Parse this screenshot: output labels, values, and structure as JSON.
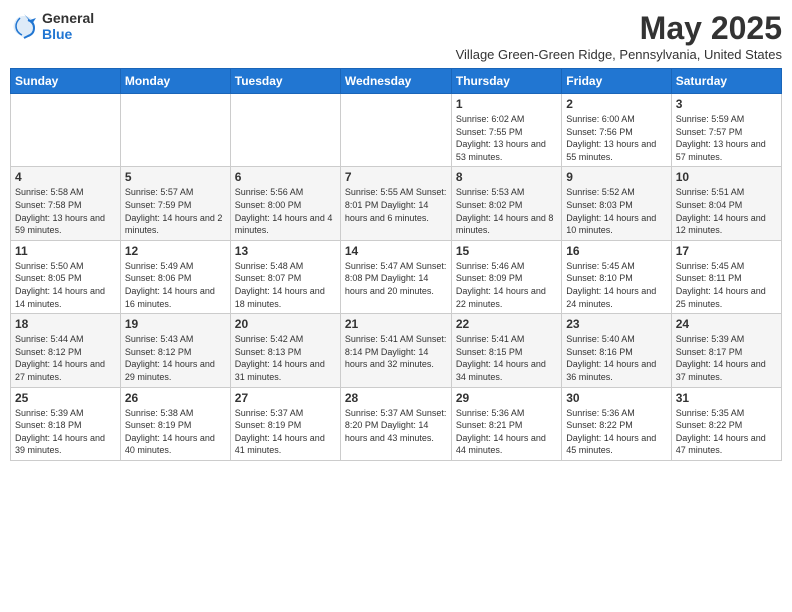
{
  "header": {
    "logo_general": "General",
    "logo_blue": "Blue",
    "month": "May 2025",
    "location": "Village Green-Green Ridge, Pennsylvania, United States"
  },
  "days_of_week": [
    "Sunday",
    "Monday",
    "Tuesday",
    "Wednesday",
    "Thursday",
    "Friday",
    "Saturday"
  ],
  "weeks": [
    {
      "row_class": "row1",
      "days": [
        {
          "num": "",
          "info": ""
        },
        {
          "num": "",
          "info": ""
        },
        {
          "num": "",
          "info": ""
        },
        {
          "num": "",
          "info": ""
        },
        {
          "num": "1",
          "info": "Sunrise: 6:02 AM\nSunset: 7:55 PM\nDaylight: 13 hours\nand 53 minutes."
        },
        {
          "num": "2",
          "info": "Sunrise: 6:00 AM\nSunset: 7:56 PM\nDaylight: 13 hours\nand 55 minutes."
        },
        {
          "num": "3",
          "info": "Sunrise: 5:59 AM\nSunset: 7:57 PM\nDaylight: 13 hours\nand 57 minutes."
        }
      ]
    },
    {
      "row_class": "row2",
      "days": [
        {
          "num": "4",
          "info": "Sunrise: 5:58 AM\nSunset: 7:58 PM\nDaylight: 13 hours\nand 59 minutes."
        },
        {
          "num": "5",
          "info": "Sunrise: 5:57 AM\nSunset: 7:59 PM\nDaylight: 14 hours\nand 2 minutes."
        },
        {
          "num": "6",
          "info": "Sunrise: 5:56 AM\nSunset: 8:00 PM\nDaylight: 14 hours\nand 4 minutes."
        },
        {
          "num": "7",
          "info": "Sunrise: 5:55 AM\nSunset: 8:01 PM\nDaylight: 14 hours\nand 6 minutes."
        },
        {
          "num": "8",
          "info": "Sunrise: 5:53 AM\nSunset: 8:02 PM\nDaylight: 14 hours\nand 8 minutes."
        },
        {
          "num": "9",
          "info": "Sunrise: 5:52 AM\nSunset: 8:03 PM\nDaylight: 14 hours\nand 10 minutes."
        },
        {
          "num": "10",
          "info": "Sunrise: 5:51 AM\nSunset: 8:04 PM\nDaylight: 14 hours\nand 12 minutes."
        }
      ]
    },
    {
      "row_class": "row3",
      "days": [
        {
          "num": "11",
          "info": "Sunrise: 5:50 AM\nSunset: 8:05 PM\nDaylight: 14 hours\nand 14 minutes."
        },
        {
          "num": "12",
          "info": "Sunrise: 5:49 AM\nSunset: 8:06 PM\nDaylight: 14 hours\nand 16 minutes."
        },
        {
          "num": "13",
          "info": "Sunrise: 5:48 AM\nSunset: 8:07 PM\nDaylight: 14 hours\nand 18 minutes."
        },
        {
          "num": "14",
          "info": "Sunrise: 5:47 AM\nSunset: 8:08 PM\nDaylight: 14 hours\nand 20 minutes."
        },
        {
          "num": "15",
          "info": "Sunrise: 5:46 AM\nSunset: 8:09 PM\nDaylight: 14 hours\nand 22 minutes."
        },
        {
          "num": "16",
          "info": "Sunrise: 5:45 AM\nSunset: 8:10 PM\nDaylight: 14 hours\nand 24 minutes."
        },
        {
          "num": "17",
          "info": "Sunrise: 5:45 AM\nSunset: 8:11 PM\nDaylight: 14 hours\nand 25 minutes."
        }
      ]
    },
    {
      "row_class": "row4",
      "days": [
        {
          "num": "18",
          "info": "Sunrise: 5:44 AM\nSunset: 8:12 PM\nDaylight: 14 hours\nand 27 minutes."
        },
        {
          "num": "19",
          "info": "Sunrise: 5:43 AM\nSunset: 8:12 PM\nDaylight: 14 hours\nand 29 minutes."
        },
        {
          "num": "20",
          "info": "Sunrise: 5:42 AM\nSunset: 8:13 PM\nDaylight: 14 hours\nand 31 minutes."
        },
        {
          "num": "21",
          "info": "Sunrise: 5:41 AM\nSunset: 8:14 PM\nDaylight: 14 hours\nand 32 minutes."
        },
        {
          "num": "22",
          "info": "Sunrise: 5:41 AM\nSunset: 8:15 PM\nDaylight: 14 hours\nand 34 minutes."
        },
        {
          "num": "23",
          "info": "Sunrise: 5:40 AM\nSunset: 8:16 PM\nDaylight: 14 hours\nand 36 minutes."
        },
        {
          "num": "24",
          "info": "Sunrise: 5:39 AM\nSunset: 8:17 PM\nDaylight: 14 hours\nand 37 minutes."
        }
      ]
    },
    {
      "row_class": "row5",
      "days": [
        {
          "num": "25",
          "info": "Sunrise: 5:39 AM\nSunset: 8:18 PM\nDaylight: 14 hours\nand 39 minutes."
        },
        {
          "num": "26",
          "info": "Sunrise: 5:38 AM\nSunset: 8:19 PM\nDaylight: 14 hours\nand 40 minutes."
        },
        {
          "num": "27",
          "info": "Sunrise: 5:37 AM\nSunset: 8:19 PM\nDaylight: 14 hours\nand 41 minutes."
        },
        {
          "num": "28",
          "info": "Sunrise: 5:37 AM\nSunset: 8:20 PM\nDaylight: 14 hours\nand 43 minutes."
        },
        {
          "num": "29",
          "info": "Sunrise: 5:36 AM\nSunset: 8:21 PM\nDaylight: 14 hours\nand 44 minutes."
        },
        {
          "num": "30",
          "info": "Sunrise: 5:36 AM\nSunset: 8:22 PM\nDaylight: 14 hours\nand 45 minutes."
        },
        {
          "num": "31",
          "info": "Sunrise: 5:35 AM\nSunset: 8:22 PM\nDaylight: 14 hours\nand 47 minutes."
        }
      ]
    }
  ]
}
